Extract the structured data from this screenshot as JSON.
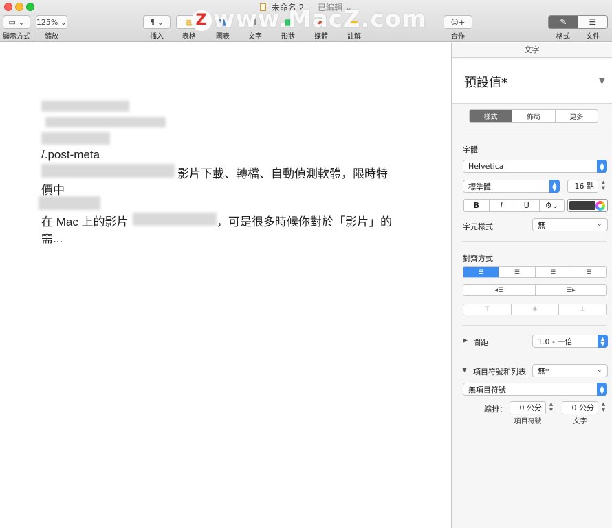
{
  "window": {
    "title": "未命名 2",
    "status": "— 已編輯",
    "status_arrow": "⌄"
  },
  "toolbar": {
    "view_label": "顯示方式",
    "zoom_value": "125%",
    "zoom_label": "縮放",
    "insert_label": "插入",
    "table_label": "表格",
    "chart_label": "圖表",
    "text_label": "文字",
    "shape_label": "形狀",
    "media_label": "媒體",
    "comment_label": "註解",
    "collab_label": "合作",
    "format_label": "格式",
    "document_label": "文件"
  },
  "watermark": {
    "badge": "Z",
    "text": "www.MacZ.com"
  },
  "document": {
    "meta_line": "/.post-meta",
    "line1": "影片下載、轉檔、自動偵測軟體，限時特",
    "line2": "價中",
    "line3_a": "在 Mac 上的影片",
    "line3_b": "，可是很多時候你對於「影片」的",
    "line4": "需..."
  },
  "sidebar": {
    "header": "文字",
    "style_name": "預設值*",
    "tabs": [
      "樣式",
      "佈局",
      "更多"
    ],
    "font_label": "字體",
    "font_family": "Helvetica",
    "font_style": "標準體",
    "font_size": "16 點",
    "bold": "B",
    "italic": "I",
    "underline": "U",
    "gear": "⚙︎",
    "char_style_label": "字元樣式",
    "char_style_value": "無",
    "align_label": "對齊方式",
    "spacing_label": "間距",
    "spacing_value": "1.0 - 一倍",
    "bullets_label": "項目符號和列表",
    "bullets_value": "無*",
    "bullet_type": "無項目符號",
    "indent_label": "縮排：",
    "indent_bullet_value": "0 公分",
    "indent_text_value": "0 公分",
    "indent_bullet_caption": "項目符號",
    "indent_text_caption": "文字"
  }
}
